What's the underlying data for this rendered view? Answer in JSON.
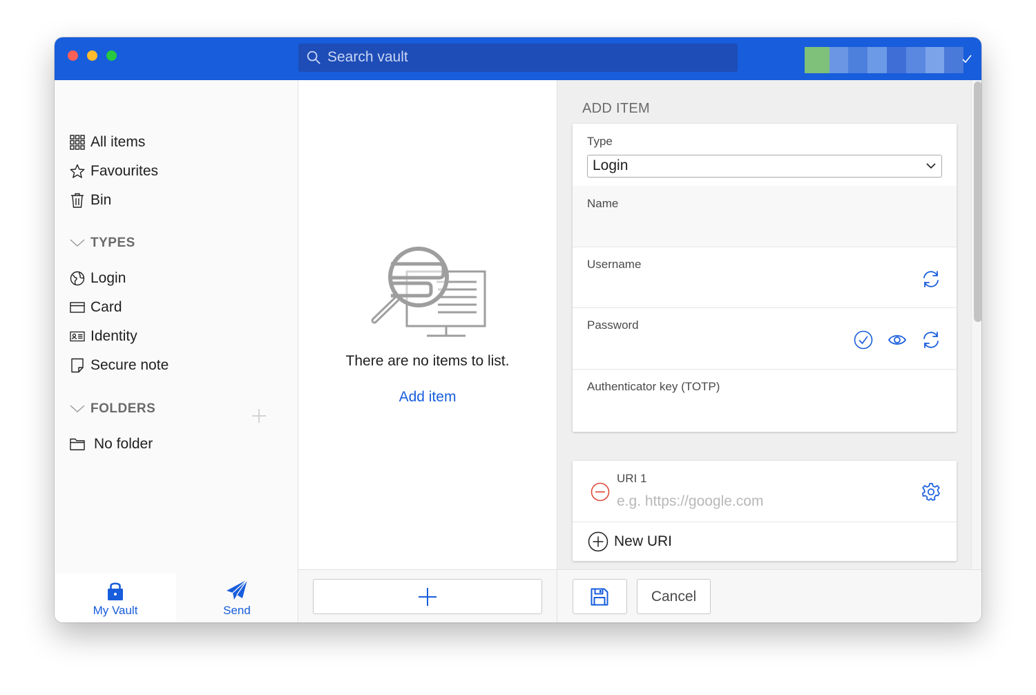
{
  "window": {
    "search_placeholder": "Search vault",
    "account_colors": [
      "#7fc07a",
      "#6b96e4",
      "#4d7fdc",
      "#6d9ae6",
      "#3f6fd6",
      "#5a88e0",
      "#7aa3ea",
      "#4a7ad9"
    ]
  },
  "sidebar": {
    "items": [
      {
        "label": "All items",
        "icon": "grid-icon"
      },
      {
        "label": "Favourites",
        "icon": "star-icon"
      },
      {
        "label": "Bin",
        "icon": "trash-icon"
      }
    ],
    "types_heading": "TYPES",
    "types": [
      {
        "label": "Login",
        "icon": "globe-icon"
      },
      {
        "label": "Card",
        "icon": "credit-card-icon"
      },
      {
        "label": "Identity",
        "icon": "id-card-icon"
      },
      {
        "label": "Secure note",
        "icon": "note-icon"
      }
    ],
    "folders_heading": "FOLDERS",
    "folders": [
      {
        "label": "No folder",
        "icon": "folder-icon"
      }
    ],
    "tabs": {
      "vault": "My Vault",
      "send": "Send"
    }
  },
  "list": {
    "empty_message": "There are no items to list.",
    "add_link": "Add item"
  },
  "detail": {
    "title": "ADD ITEM",
    "type_label": "Type",
    "type_value": "Login",
    "name_label": "Name",
    "username_label": "Username",
    "password_label": "Password",
    "totp_label": "Authenticator key (TOTP)",
    "uri_label": "URI 1",
    "uri_placeholder": "e.g. https://google.com",
    "new_uri": "New URI",
    "cancel": "Cancel"
  },
  "colors": {
    "brand": "#175ddc",
    "danger": "#dd4b39"
  }
}
